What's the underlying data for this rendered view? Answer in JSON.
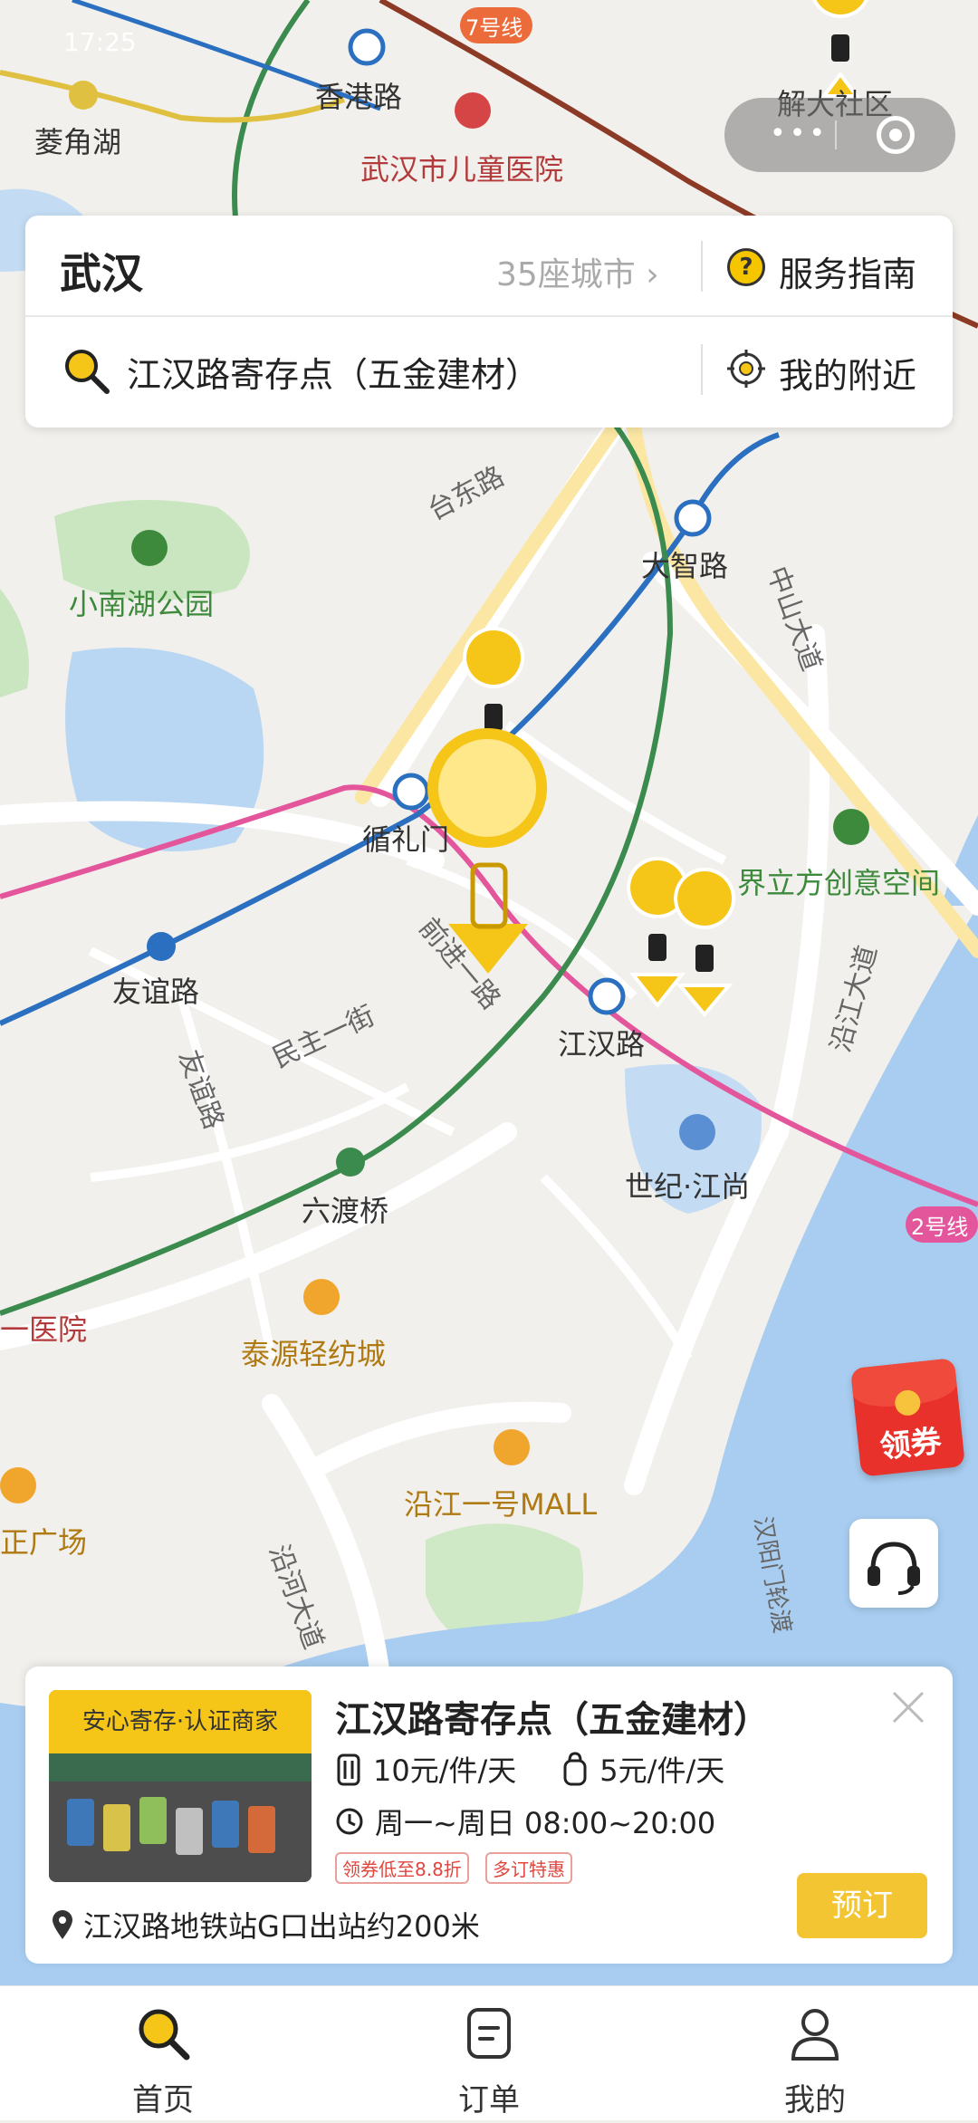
{
  "status_bar": {
    "time": "17:25"
  },
  "map": {
    "subway_badges": [
      "7号线",
      "2号线"
    ],
    "stations": [
      "香港路",
      "大智路",
      "循礼门",
      "友谊路",
      "江汉路",
      "六渡桥"
    ],
    "places": [
      "菱角湖",
      "武汉市儿童医院",
      "解大社区",
      "小南湖公园",
      "界立方创意空间",
      "世纪·江尚",
      "泰源轻纺城",
      "沿江一号MALL"
    ],
    "roads": [
      "台东路",
      "中山大道",
      "前进一路",
      "民主一街",
      "友谊路",
      "沿江大道",
      "沿河大道",
      "汉阳门轮渡"
    ],
    "edge_labels": [
      "一医院",
      "正广场"
    ]
  },
  "search_card": {
    "city": "武汉",
    "city_count": "35座城市",
    "guide_label": "服务指南",
    "search_value": "江汉路寄存点（五金建材）",
    "nearby_label": "我的附近"
  },
  "coupon": {
    "label": "领券"
  },
  "shop_card": {
    "badge": "安心寄存·认证商家",
    "title": "江汉路寄存点（五金建材）",
    "price_luggage": "10元/件/天",
    "price_bag": "5元/件/天",
    "hours": "周一~周日 08:00~20:00",
    "tags": [
      "领券低至8.8折",
      "多订特惠"
    ],
    "location": "江汉路地铁站G口出站约200米",
    "book_label": "预订"
  },
  "tabs": [
    {
      "label": "首页",
      "icon": "search-icon",
      "active": true
    },
    {
      "label": "订单",
      "icon": "order-icon",
      "active": false
    },
    {
      "label": "我的",
      "icon": "profile-icon",
      "active": false
    }
  ],
  "colors": {
    "accent": "#f5c518",
    "line2": "#e4569c",
    "blue_line": "#2a6fc0",
    "green_line": "#3b8a4e",
    "water": "#a8cdf0"
  }
}
